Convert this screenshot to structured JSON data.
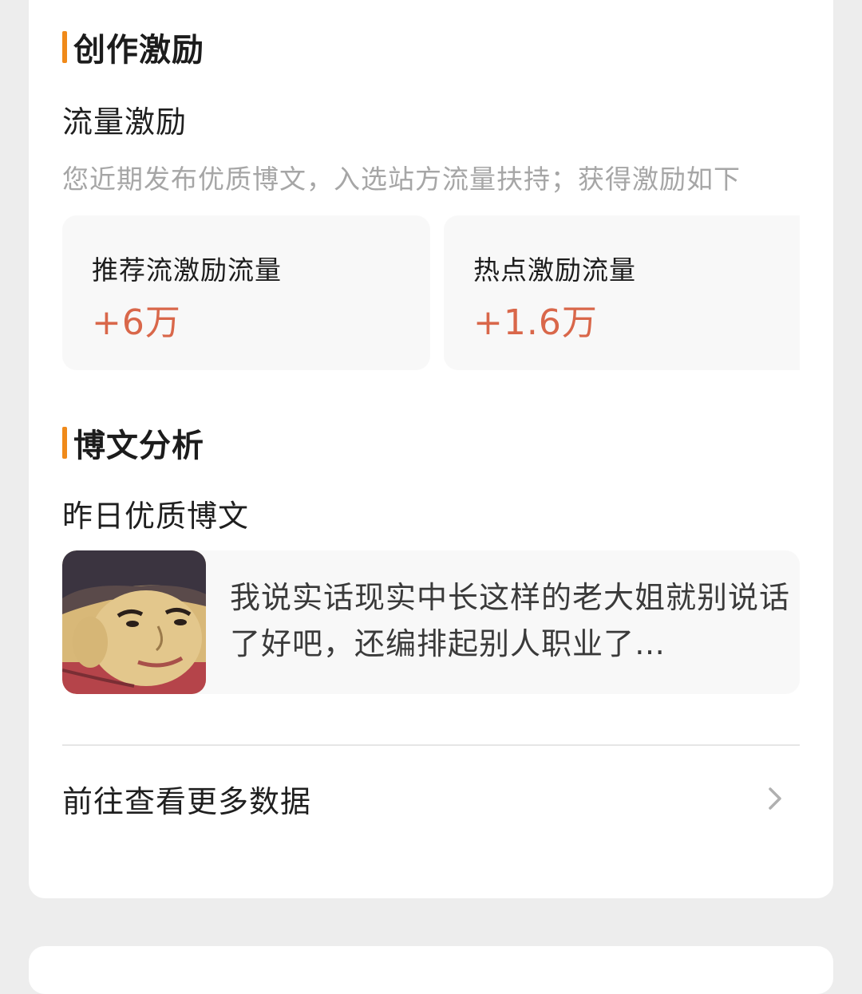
{
  "incentive": {
    "title": "创作激励",
    "subtitle": "流量激励",
    "description": "您近期发布优质博文，入选站方流量扶持；获得激励如下",
    "stats": [
      {
        "label": "推荐流激励流量",
        "value": "+6万"
      },
      {
        "label": "热点激励流量",
        "value": "+1.6万"
      }
    ]
  },
  "analysis": {
    "title": "博文分析",
    "subtitle": "昨日优质博文",
    "post": {
      "text": "我说实话现实中长这样的老大姐就别说话了好吧，还编排起别人职业了…",
      "thumbnail_icon": "portrait-thumbnail"
    },
    "more_label": "前往查看更多数据",
    "more_icon": "chevron-right-icon"
  },
  "colors": {
    "accent": "#f08a1a",
    "value": "#d9674a",
    "background": "#ededed"
  }
}
